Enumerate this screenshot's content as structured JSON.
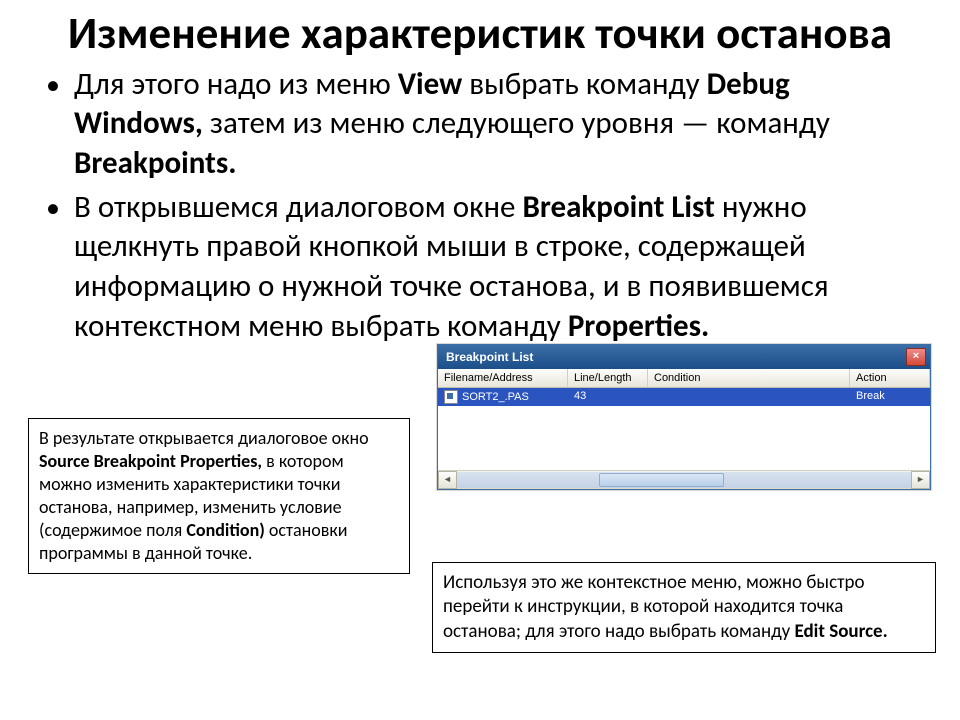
{
  "title": "Изменение характеристик точки останова",
  "bullets": [
    {
      "pre1": "Для этого надо из меню ",
      "b1": "View",
      "mid1": " выбрать команду ",
      "b2": "Debug Windows,",
      "mid2": " затем из меню следующего уровня — команду ",
      "b3": "Breakpoints."
    },
    {
      "pre1": "В открывшемся диалоговом окне ",
      "b1": "Breakpoint List",
      "mid1": " нужно щелкнуть правой кнопкой мыши в строке, содержащей информацию о нужной точке останова, и в появившемся контекстном меню выбрать команду ",
      "b2": "Properties."
    }
  ],
  "window": {
    "title": "Breakpoint List",
    "close": "×",
    "headers": {
      "fa": "Filename/Address",
      "ll": "Line/Length",
      "cond": "Condition",
      "act": "Action"
    },
    "row": {
      "fa": "SORT2_.PAS",
      "ll": "43",
      "cond": "",
      "act": "Break"
    },
    "scroll_left": "◄",
    "scroll_right": "►"
  },
  "callout_left": {
    "t1": "В результате открывается диалоговое окно ",
    "b1": "Source Breakpoint Properties,",
    "t2": " в котором можно изменить характеристики точки останова, например, изменить условие (содержимое поля ",
    "b2": "Condition)",
    "t3": " остановки программы в данной точке."
  },
  "callout_right": {
    "t1": "Используя это же контекстное меню, можно быстро перейти к инструкции, в которой находится точка останова; для этого надо выбрать команду ",
    "b1": "Edit Source."
  }
}
